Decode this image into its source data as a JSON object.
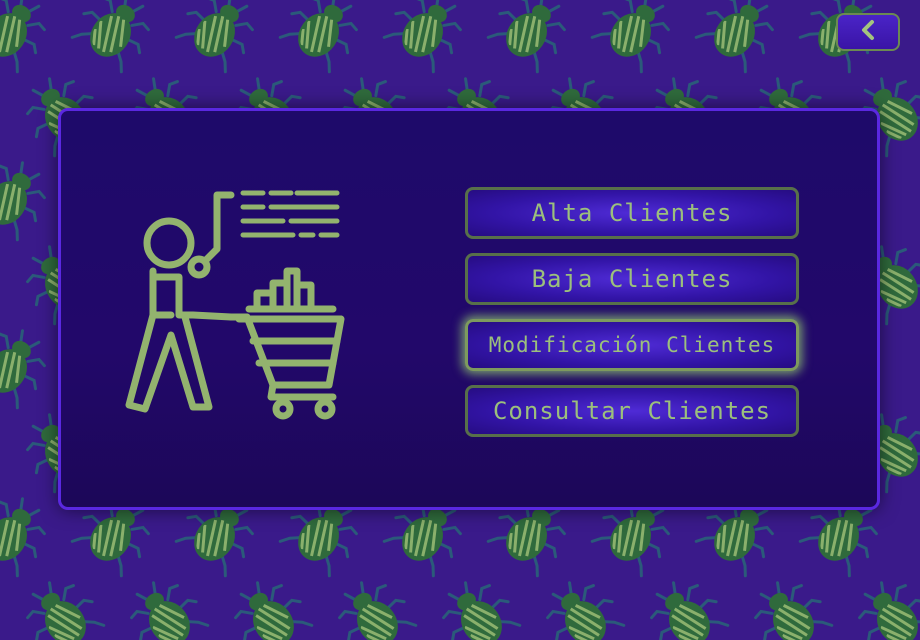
{
  "background": {
    "pattern": "beetle-pattern",
    "base_color": "#3a1a8a",
    "beetle_color": "#2f6a3c",
    "stripe_color": "#8ab06c"
  },
  "back_button": {
    "icon": "chevron-left-icon"
  },
  "illustration": {
    "icon": "shopper-with-cart-icon",
    "color": "#93b36e"
  },
  "menu": {
    "items": [
      {
        "label": "Alta Clientes"
      },
      {
        "label": "Baja Clientes"
      },
      {
        "label": "Modificación Clientes",
        "highlighted": true
      },
      {
        "label": "Consultar Clientes"
      }
    ]
  }
}
